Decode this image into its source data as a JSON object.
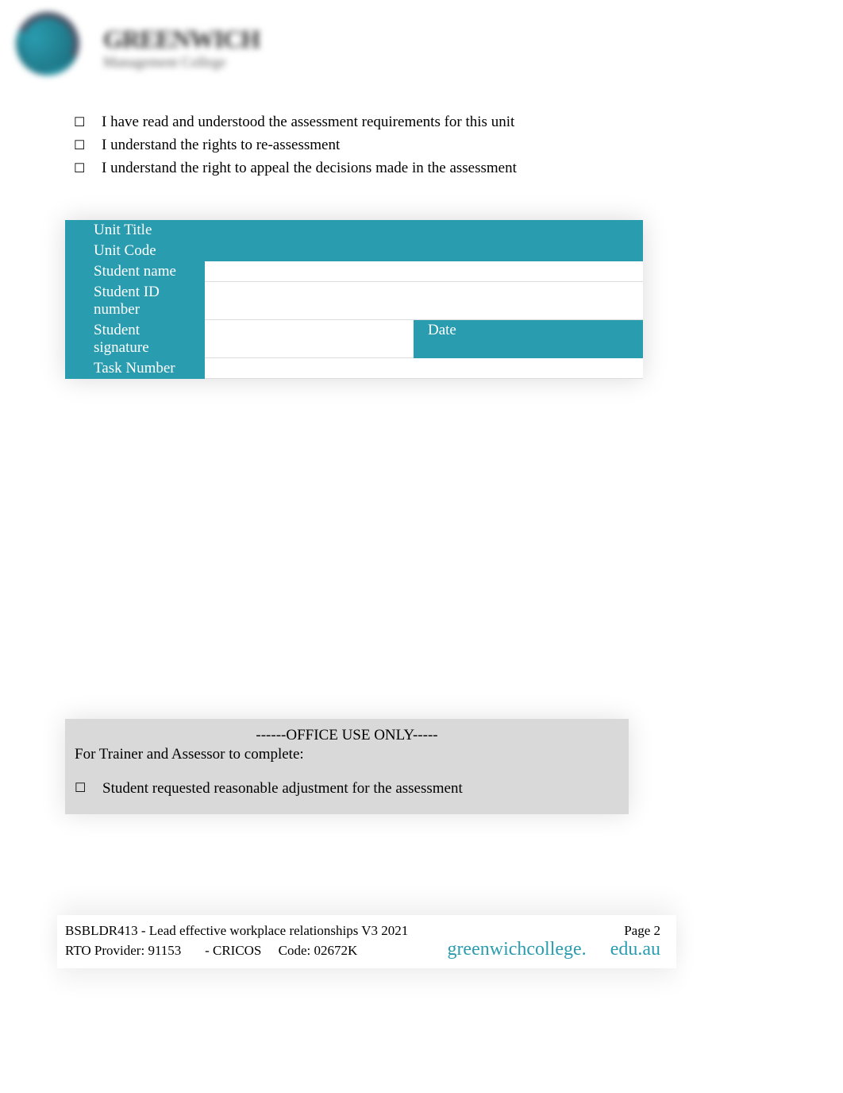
{
  "logo": {
    "main": "GREENWICH",
    "sub": "Management College"
  },
  "checklist": {
    "items": [
      "I have read and understood the assessment requirements for this unit",
      "I understand the rights to re-assessment",
      "I understand the right to appeal the decisions made in the assessment"
    ]
  },
  "form": {
    "unit_title_label": "Unit Title",
    "unit_code_label": "Unit Code",
    "student_name_label": "Student name",
    "student_id_label": "Student ID number",
    "student_signature_label": "Student signature",
    "date_label": "Date",
    "task_number_label": "Task Number",
    "unit_title_value": "",
    "unit_code_value": "",
    "student_name_value": "",
    "student_id_value": "",
    "student_signature_value": "",
    "date_value": "",
    "task_number_value": ""
  },
  "office_use": {
    "header": "------OFFICE USE ONLY-----",
    "sub": "For Trainer and Assessor to complete:",
    "item": "Student requested reasonable adjustment for the assessment"
  },
  "footer": {
    "unit_info": "BSBLDR413 - Lead effective workplace relationships V3 2021",
    "page": "Page 2",
    "rto": "RTO Provider: 91153",
    "cricos_sep": "- CRICOS",
    "cricos_code": "Code: 02672K",
    "url_part1": "greenwichcollege.",
    "url_part2": "edu.au"
  }
}
